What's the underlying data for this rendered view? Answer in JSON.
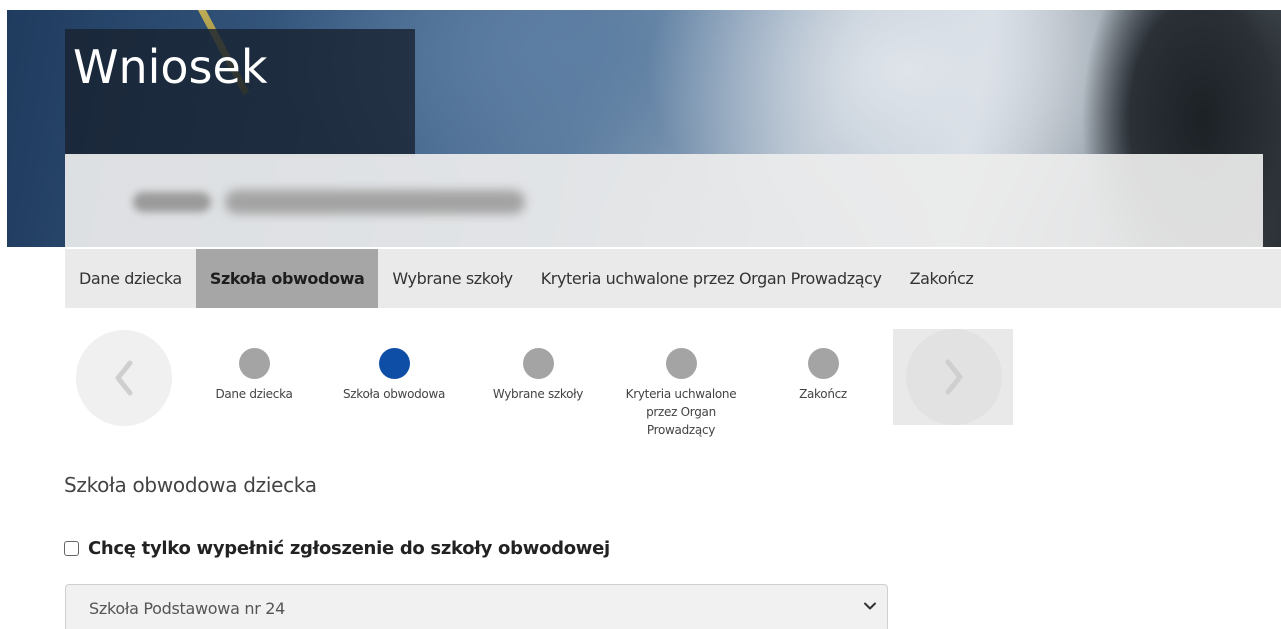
{
  "header": {
    "title": "Wniosek"
  },
  "tabs": [
    {
      "label": "Dane dziecka",
      "active": false
    },
    {
      "label": "Szkoła obwodowa",
      "active": true
    },
    {
      "label": "Wybrane szkoły",
      "active": false
    },
    {
      "label": "Kryteria uchwalone przez Organ Prowadzący",
      "active": false
    },
    {
      "label": "Zakończ",
      "active": false
    }
  ],
  "stepper": {
    "prev_icon": "chevron-left-icon",
    "next_icon": "chevron-right-icon",
    "steps": [
      {
        "label": "Dane dziecka",
        "active": false
      },
      {
        "label": "Szkoła obwodowa",
        "active": true
      },
      {
        "label": "Wybrane szkoły",
        "active": false
      },
      {
        "label": "Kryteria uchwalone przez Organ Prowadzący",
        "active": false
      },
      {
        "label": "Zakończ",
        "active": false
      }
    ],
    "active_color": "#0f4ea6",
    "inactive_color": "#a4a4a4"
  },
  "content": {
    "section_title": "Szkoła obwodowa dziecka",
    "checkbox": {
      "label": "Chcę tylko wypełnić zgłoszenie do szkoły obwodowej",
      "checked": false
    },
    "school_select": {
      "value": "Szkoła Podstawowa nr 24"
    }
  }
}
